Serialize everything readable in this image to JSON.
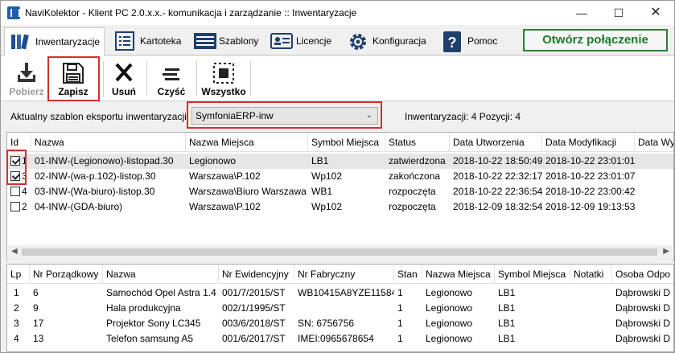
{
  "window": {
    "title": "NaviKolektor - Klient PC 2.0.x.x.- komunikacja i zarządzanie :: Inwentaryzacje",
    "minimize": "—",
    "maximize": "☐",
    "close": "✕"
  },
  "tabs": [
    {
      "label": "Inwentaryzacje",
      "icon": "barcode-books-icon",
      "active": true
    },
    {
      "label": "Kartoteka",
      "icon": "list-icon",
      "active": false
    },
    {
      "label": "Szablony",
      "icon": "template-icon",
      "active": false
    },
    {
      "label": "Licencje",
      "icon": "id-card-icon",
      "active": false
    },
    {
      "label": "Konfiguracja",
      "icon": "gear-icon",
      "active": false
    },
    {
      "label": "Pomoc",
      "icon": "help-icon",
      "active": false
    }
  ],
  "connect_button": "Otwórz połączenie",
  "toolbar": {
    "download": "Pobierz",
    "save": "Zapisz",
    "delete": "Usuń",
    "clear": "Czyść",
    "all": "Wszystko"
  },
  "template": {
    "label": "Aktualny szablon eksportu inwentaryzacji",
    "selected": "SymfoniaERP-inw",
    "info": "Inwentaryzacji: 4 Pozycji: 4"
  },
  "inventories": {
    "columns": [
      "Id",
      "Nazwa",
      "Nazwa Miejsca",
      "Symbol Miejsca",
      "Status",
      "Data Utworzenia",
      "Data Modyfikacji",
      "Data Wy"
    ],
    "rows": [
      {
        "checked": true,
        "id": "1",
        "name": "01-INW-(Legionowo)-listopad.30",
        "place": "Legionowo",
        "symbol": "LB1",
        "status": "zatwierdzona",
        "created": "2018-10-22 18:50:49",
        "modified": "2018-10-22 23:01:01",
        "selected": true
      },
      {
        "checked": true,
        "id": "3",
        "name": "02-INW-(wa-p.102)-listop.30",
        "place": "Warszawa\\P.102",
        "symbol": "Wp102",
        "status": "zakończona",
        "created": "2018-10-22 22:32:17",
        "modified": "2018-10-22 23:01:07",
        "selected": false
      },
      {
        "checked": false,
        "id": "4",
        "name": "03-INW-(Wa-biuro)-listop.30",
        "place": "Warszawa\\Biuro Warszawa",
        "symbol": "WB1",
        "status": "rozpoczęta",
        "created": "2018-10-22 22:36:54",
        "modified": "2018-10-22 23:00:42",
        "selected": false
      },
      {
        "checked": false,
        "id": "2",
        "name": "04-INW-(GDA-biuro)",
        "place": "Warszawa\\P.102",
        "symbol": "Wp102",
        "status": "rozpoczęta",
        "created": "2018-12-09 18:32:54",
        "modified": "2018-12-09 19:13:53",
        "selected": false
      }
    ]
  },
  "items": {
    "columns": [
      "Lp",
      "Nr Porządkowy",
      "Nazwa",
      "Nr Ewidencyjny",
      "Nr Fabryczny",
      "Stan",
      "Nazwa Miejsca",
      "Symbol Miejsca",
      "Notatki",
      "Osoba Odpo"
    ],
    "rows": [
      {
        "lp": "1",
        "nr": "6",
        "name": "Samochód Opel Astra 1.4",
        "ev": "001/7/2015/ST",
        "fab": "WB10415A8YZE11584",
        "stan": "1",
        "place": "Legionowo",
        "symbol": "LB1",
        "notes": "",
        "person": "Dąbrowski D"
      },
      {
        "lp": "2",
        "nr": "9",
        "name": "Hala produkcyjna",
        "ev": "002/1/1995/ST",
        "fab": "",
        "stan": "1",
        "place": "Legionowo",
        "symbol": "LB1",
        "notes": "",
        "person": "Dąbrowski D"
      },
      {
        "lp": "3",
        "nr": "17",
        "name": "Projektor Sony LC345",
        "ev": "003/6/2018/ST",
        "fab": "SN: 6756756",
        "stan": "1",
        "place": "Legionowo",
        "symbol": "LB1",
        "notes": "",
        "person": "Dąbrowski D"
      },
      {
        "lp": "4",
        "nr": "13",
        "name": "Telefon samsung A5",
        "ev": "001/6/2017/ST",
        "fab": "IMEI:0965678654",
        "stan": "1",
        "place": "Legionowo",
        "symbol": "LB1",
        "notes": "",
        "person": "Dąbrowski D"
      }
    ]
  },
  "scroll": {
    "left": "◀",
    "right": "▶"
  }
}
